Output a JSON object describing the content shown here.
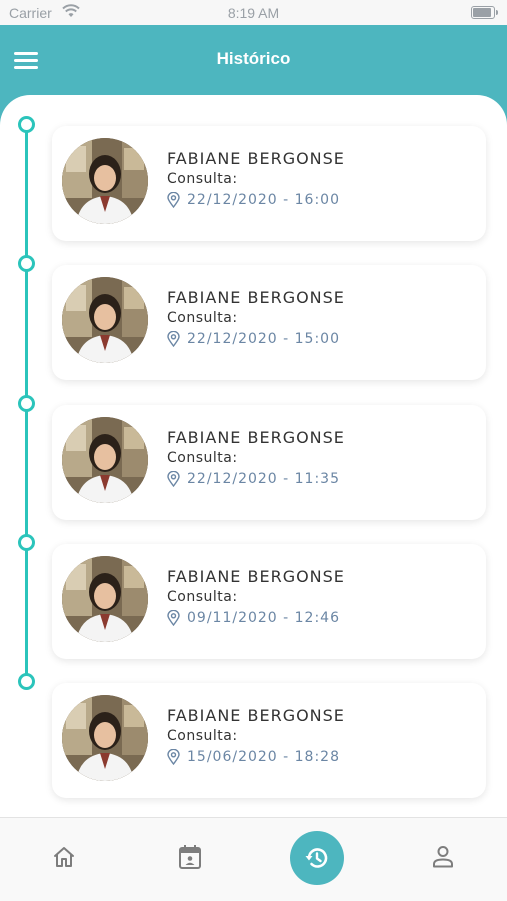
{
  "status_bar": {
    "carrier": "Carrier",
    "time": "8:19 AM"
  },
  "header": {
    "title": "Histórico",
    "menu_icon": "hamburger-menu-icon"
  },
  "theme": {
    "header_color": "#4db6bf",
    "timeline_color": "#2bc4bb",
    "date_color": "#6b86a4"
  },
  "history": [
    {
      "name": "FABIANE BERGONSE",
      "type": "Consulta:",
      "datetime": "22/12/2020 - 16:00"
    },
    {
      "name": "FABIANE BERGONSE",
      "type": "Consulta:",
      "datetime": "22/12/2020 - 15:00"
    },
    {
      "name": "FABIANE BERGONSE",
      "type": "Consulta:",
      "datetime": "22/12/2020 - 11:35"
    },
    {
      "name": "FABIANE BERGONSE",
      "type": "Consulta:",
      "datetime": "09/11/2020 - 12:46"
    },
    {
      "name": "FABIANE BERGONSE",
      "type": "Consulta:",
      "datetime": "15/06/2020 - 18:28"
    }
  ],
  "tabbar": {
    "tabs": [
      {
        "icon": "home-icon",
        "active": false
      },
      {
        "icon": "calendar-icon",
        "active": false
      },
      {
        "icon": "history-icon",
        "active": true
      },
      {
        "icon": "profile-icon",
        "active": false
      }
    ]
  }
}
